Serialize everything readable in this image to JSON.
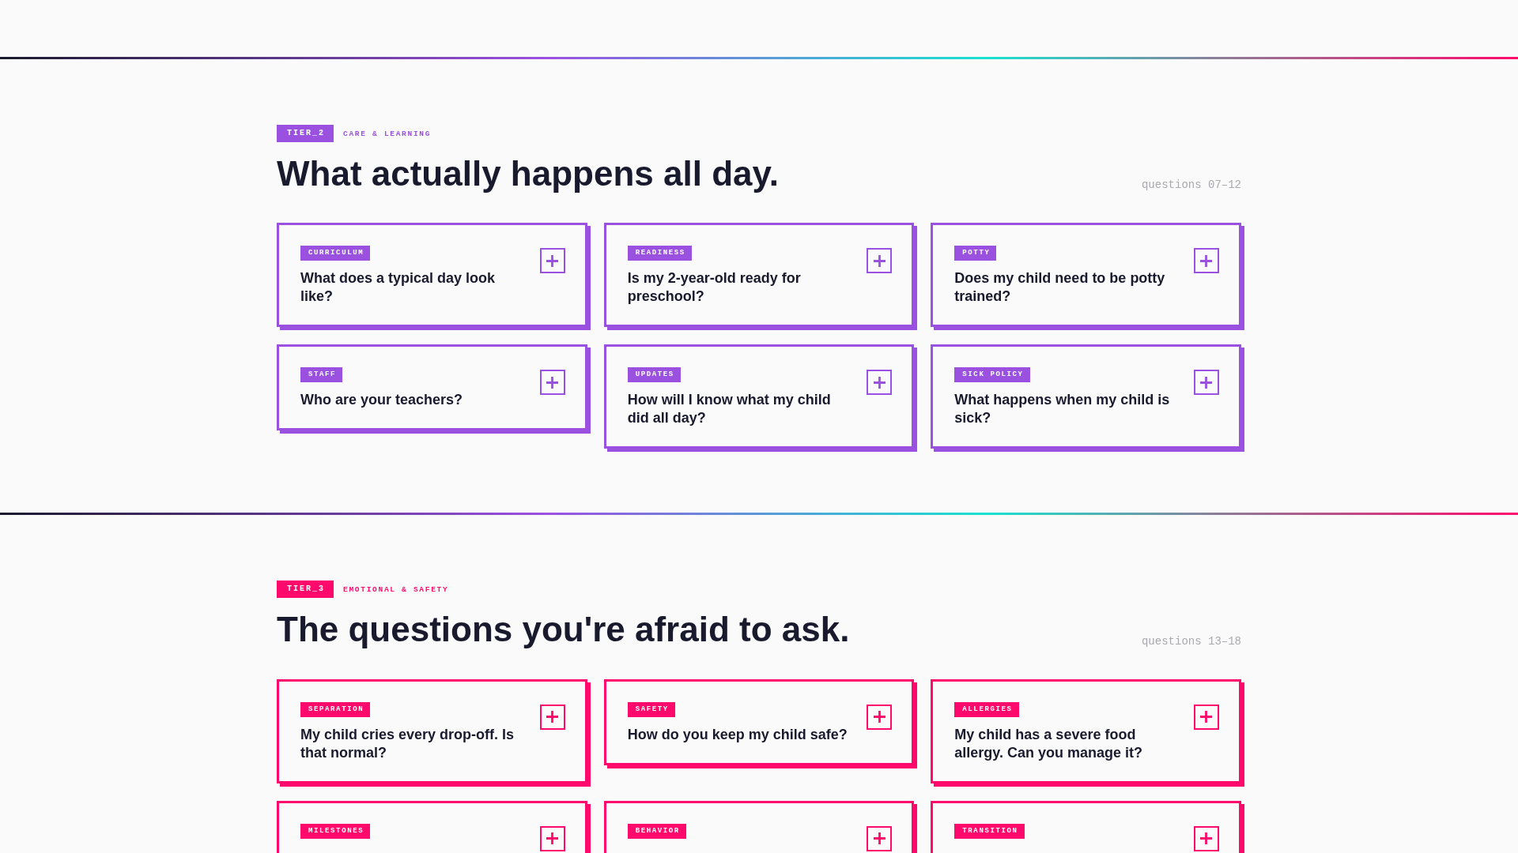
{
  "sections": [
    {
      "tier": "TIER_2",
      "category": "CARE & LEARNING",
      "color": "#9b51e0",
      "title": "What actually happens all day.",
      "range": "questions 07–12",
      "questions": [
        {
          "tag": "CURRICULUM",
          "question": "What does a typical day look like?",
          "expanded": false
        },
        {
          "tag": "READINESS",
          "question": "Is my 2-year-old ready for preschool?",
          "expanded": false
        },
        {
          "tag": "POTTY",
          "question": "Does my child need to be potty trained?",
          "expanded": false
        },
        {
          "tag": "STAFF",
          "question": "Who are your teachers?",
          "expanded": false
        },
        {
          "tag": "UPDATES",
          "question": "How will I know what my child did all day?",
          "expanded": false
        },
        {
          "tag": "SICK POLICY",
          "question": "What happens when my child is sick?",
          "expanded": false
        }
      ]
    },
    {
      "tier": "TIER_3",
      "category": "EMOTIONAL & SAFETY",
      "color": "#ff0a6c",
      "title": "The questions you're afraid to ask.",
      "range": "questions 13–18",
      "questions": [
        {
          "tag": "SEPARATION",
          "question": "My child cries every drop-off. Is that normal?",
          "expanded": false
        },
        {
          "tag": "SAFETY",
          "question": "How do you keep my child safe?",
          "expanded": false
        },
        {
          "tag": "ALLERGIES",
          "question": "My child has a severe food allergy. Can you manage it?",
          "expanded": false
        },
        {
          "tag": "MILESTONES",
          "expanded": false
        },
        {
          "tag": "BEHAVIOR",
          "expanded": false
        },
        {
          "tag": "TRANSITION",
          "expanded": false
        }
      ]
    }
  ]
}
